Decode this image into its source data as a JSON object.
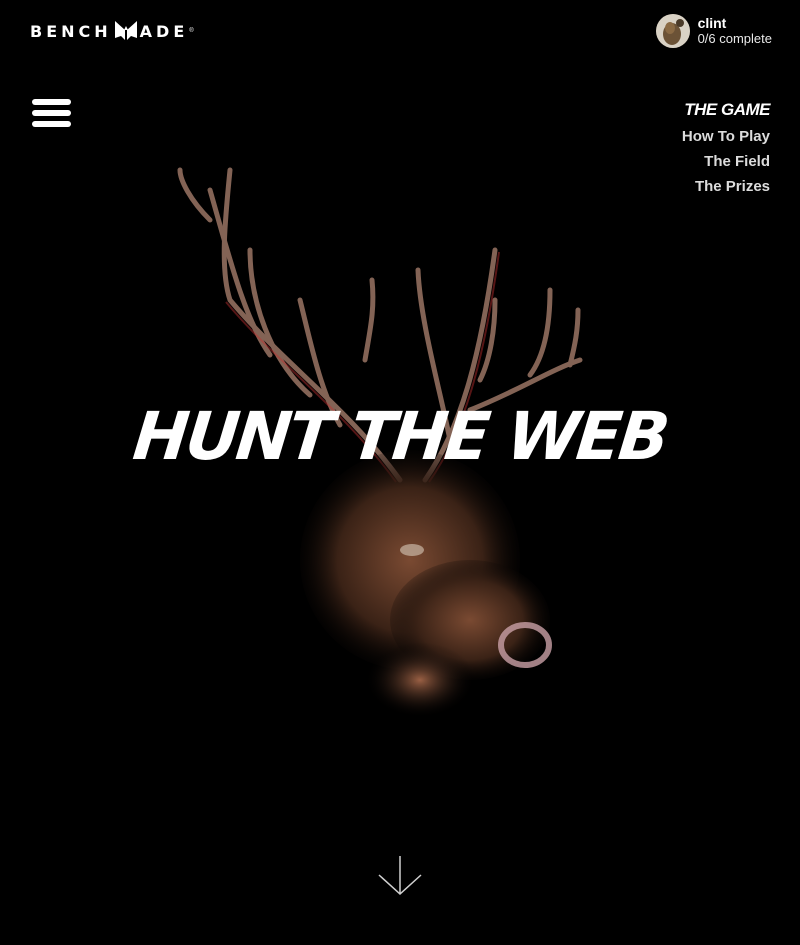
{
  "brand": {
    "logo_left": "BENCH",
    "logo_right": "ADE",
    "logo_icon": "butterfly-logo-icon"
  },
  "user": {
    "name": "clint",
    "progress": "0/6 complete",
    "avatar_icon": "avatar-photo"
  },
  "menu": {
    "icon": "hamburger-menu-icon"
  },
  "nav": {
    "title": "THE GAME",
    "items": [
      "How To Play",
      "The Field",
      "The Prizes"
    ]
  },
  "hero": {
    "title": "HUNT THE WEB",
    "image": "elk-head-image",
    "scroll_icon": "arrow-down-icon"
  }
}
